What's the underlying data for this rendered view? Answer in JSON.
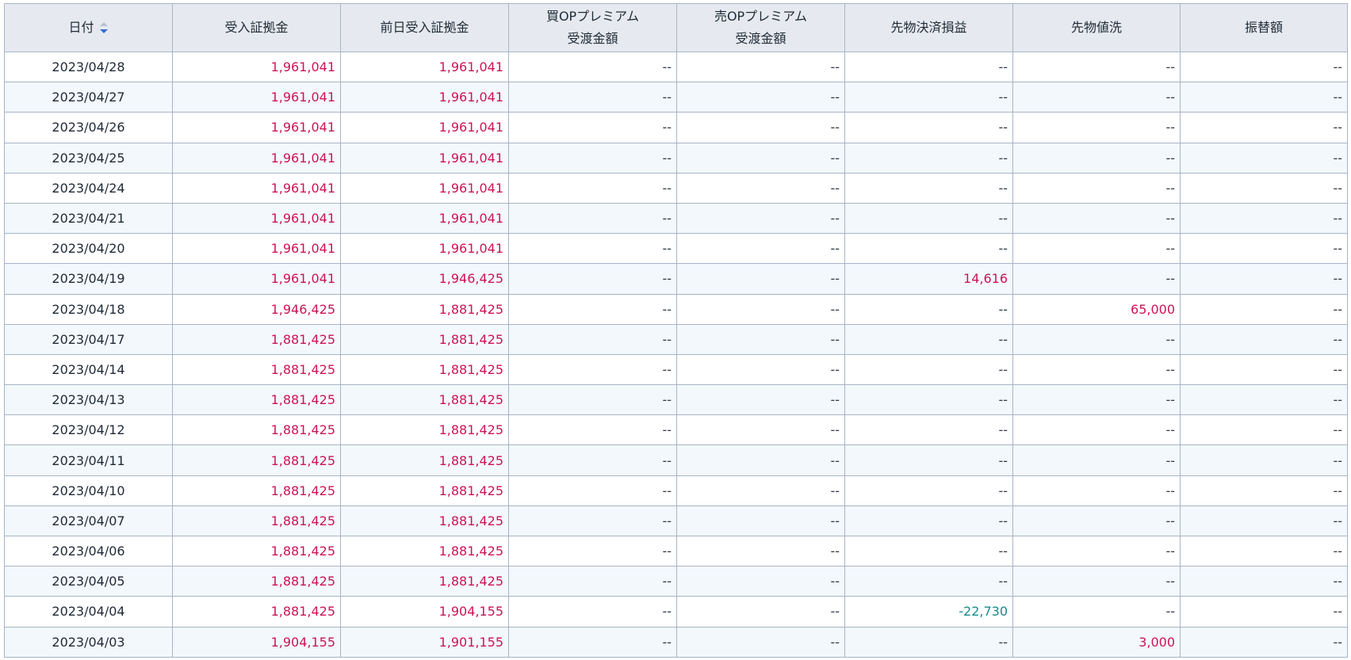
{
  "table": {
    "columns": [
      {
        "key": "date",
        "label": "日付",
        "sortable": true
      },
      {
        "key": "deposit",
        "label": "受入証拠金"
      },
      {
        "key": "prev_deposit",
        "label": "前日受入証拠金"
      },
      {
        "key": "buy_op",
        "label_line1": "買OPプレミアム",
        "label_line2": "受渡金額"
      },
      {
        "key": "sell_op",
        "label_line1": "売OPプレミアム",
        "label_line2": "受渡金額"
      },
      {
        "key": "fut_pl",
        "label": "先物決済損益"
      },
      {
        "key": "fut_mtm",
        "label": "先物値洗"
      },
      {
        "key": "transfer",
        "label": "振替額"
      }
    ],
    "rows": [
      [
        "2023/04/28",
        "1,961,041",
        "1,961,041",
        "--",
        "--",
        "--",
        "--",
        "--"
      ],
      [
        "2023/04/27",
        "1,961,041",
        "1,961,041",
        "--",
        "--",
        "--",
        "--",
        "--"
      ],
      [
        "2023/04/26",
        "1,961,041",
        "1,961,041",
        "--",
        "--",
        "--",
        "--",
        "--"
      ],
      [
        "2023/04/25",
        "1,961,041",
        "1,961,041",
        "--",
        "--",
        "--",
        "--",
        "--"
      ],
      [
        "2023/04/24",
        "1,961,041",
        "1,961,041",
        "--",
        "--",
        "--",
        "--",
        "--"
      ],
      [
        "2023/04/21",
        "1,961,041",
        "1,961,041",
        "--",
        "--",
        "--",
        "--",
        "--"
      ],
      [
        "2023/04/20",
        "1,961,041",
        "1,961,041",
        "--",
        "--",
        "--",
        "--",
        "--"
      ],
      [
        "2023/04/19",
        "1,961,041",
        "1,946,425",
        "--",
        "--",
        "14,616",
        "--",
        "--"
      ],
      [
        "2023/04/18",
        "1,946,425",
        "1,881,425",
        "--",
        "--",
        "--",
        "65,000",
        "--"
      ],
      [
        "2023/04/17",
        "1,881,425",
        "1,881,425",
        "--",
        "--",
        "--",
        "--",
        "--"
      ],
      [
        "2023/04/14",
        "1,881,425",
        "1,881,425",
        "--",
        "--",
        "--",
        "--",
        "--"
      ],
      [
        "2023/04/13",
        "1,881,425",
        "1,881,425",
        "--",
        "--",
        "--",
        "--",
        "--"
      ],
      [
        "2023/04/12",
        "1,881,425",
        "1,881,425",
        "--",
        "--",
        "--",
        "--",
        "--"
      ],
      [
        "2023/04/11",
        "1,881,425",
        "1,881,425",
        "--",
        "--",
        "--",
        "--",
        "--"
      ],
      [
        "2023/04/10",
        "1,881,425",
        "1,881,425",
        "--",
        "--",
        "--",
        "--",
        "--"
      ],
      [
        "2023/04/07",
        "1,881,425",
        "1,881,425",
        "--",
        "--",
        "--",
        "--",
        "--"
      ],
      [
        "2023/04/06",
        "1,881,425",
        "1,881,425",
        "--",
        "--",
        "--",
        "--",
        "--"
      ],
      [
        "2023/04/05",
        "1,881,425",
        "1,881,425",
        "--",
        "--",
        "--",
        "--",
        "--"
      ],
      [
        "2023/04/04",
        "1,881,425",
        "1,904,155",
        "--",
        "--",
        "-22,730",
        "--",
        "--"
      ],
      [
        "2023/04/03",
        "1,904,155",
        "1,901,155",
        "--",
        "--",
        "--",
        "3,000",
        "--"
      ]
    ]
  },
  "colors": {
    "positive": "#cc1456",
    "negative": "#1a8a8a",
    "sort_active": "#2f6fd0",
    "sort_inactive": "#b9c2d0"
  },
  "icons": {
    "sort": "sort-descending-icon"
  }
}
